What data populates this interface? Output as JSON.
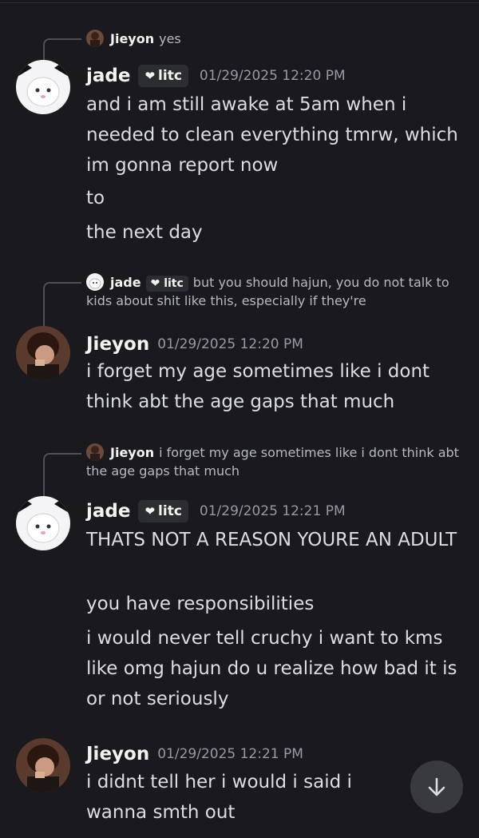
{
  "messages": [
    {
      "reply": {
        "name": "Jieyon",
        "text": "yes"
      },
      "user": "jade",
      "tag": "litc",
      "timestamp": "01/29/2025 12:20 PM",
      "lines": [
        "and i am still awake at 5am when i needed to clean everything tmrw, which im gonna report now",
        "to",
        "the next day"
      ]
    },
    {
      "reply": {
        "name": "jade",
        "tag": "litc",
        "text": "but you should hajun, you do not talk to kids about shit like this, especially if they're"
      },
      "user": "Jieyon",
      "timestamp": "01/29/2025 12:20 PM",
      "lines": [
        "i forget my age sometimes like i dont think abt the age gaps that much"
      ]
    },
    {
      "reply": {
        "name": "Jieyon",
        "text": "i forget my age sometimes like i dont think abt the age gaps that much"
      },
      "user": "jade",
      "tag": "litc",
      "timestamp": "01/29/2025 12:21 PM",
      "lines": [
        "THATS NOT A REASON YOURE AN ADULT",
        "you have responsibilities",
        "i would never tell cruchy i want to kms like omg hajun do u realize how bad it is or not seriously"
      ]
    },
    {
      "user": "Jieyon",
      "timestamp": "01/29/2025 12:21 PM",
      "lines": [
        "i didnt tell her i would i said i wanna smth out"
      ]
    }
  ],
  "icons": {
    "tag_icon": "heart-icon",
    "scroll": "arrow-down-icon"
  },
  "colors": {
    "background": "#1a1a1e",
    "username": "#f2f3f5",
    "timestamp": "#949ba4",
    "text": "#dbdee1"
  }
}
